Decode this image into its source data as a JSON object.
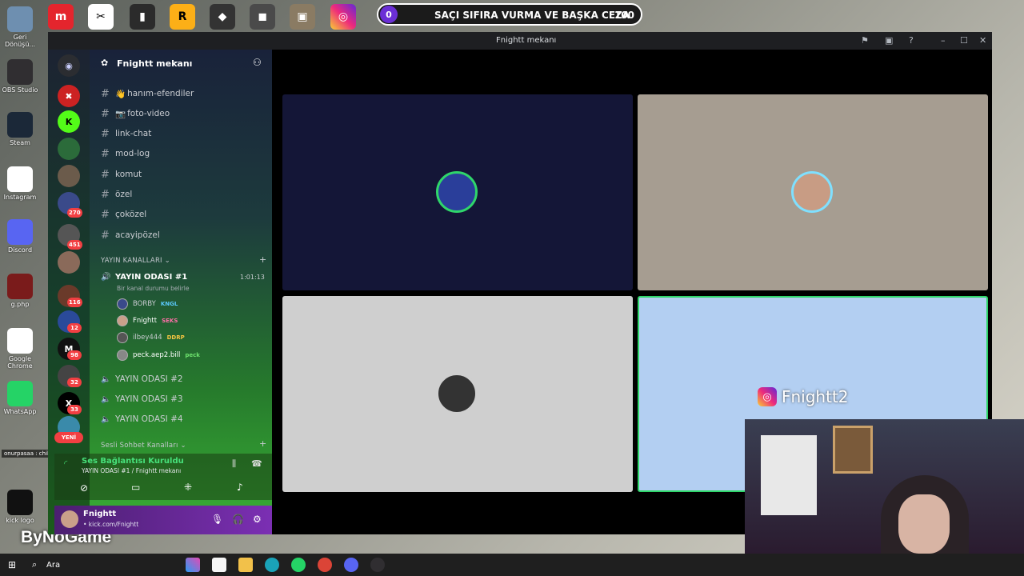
{
  "desktop": {
    "icons": [
      {
        "label": "Geri Dönüşü...",
        "icon": "recycle-bin-icon",
        "color": "#6e8fb0"
      },
      {
        "label": "OBS Studio",
        "icon": "obs-icon",
        "color": "#302e31"
      },
      {
        "label": "Steam",
        "icon": "steam-icon",
        "color": "#1b2838"
      },
      {
        "label": "Instagram",
        "icon": "chrome-icon",
        "color": "#ffffff"
      },
      {
        "label": "Discord",
        "icon": "discord-icon",
        "color": "#5865f2"
      },
      {
        "label": "g.php",
        "icon": "file-icon",
        "color": "#7a1b1b"
      },
      {
        "label": "Google Chrome",
        "icon": "chrome-icon",
        "color": "#ffffff"
      },
      {
        "label": "WhatsApp",
        "icon": "whatsapp-icon",
        "color": "#25d366"
      },
      {
        "label": "kick logo",
        "icon": "kick-icon",
        "color": "#111111"
      }
    ],
    "chat_overlay": "onurpasaa : chill guys",
    "bynogame": "ByNoGame"
  },
  "banner": {
    "left_value": "0",
    "title": "SAÇI SIFIRA VURMA VE BAŞKA CEZA",
    "right_value": "100"
  },
  "window": {
    "title": "Fnightt mekanı",
    "guild_name": "Fnightt mekanı",
    "text_channels": [
      {
        "name": "hanım-efendiler",
        "emoji": "👋"
      },
      {
        "name": "foto-video",
        "emoji": "📷"
      },
      {
        "name": "link-chat",
        "emoji": ""
      },
      {
        "name": "mod-log",
        "emoji": ""
      },
      {
        "name": "komut",
        "emoji": ""
      },
      {
        "name": "özel",
        "emoji": ""
      },
      {
        "name": "çoközel",
        "emoji": ""
      },
      {
        "name": "acayipözel",
        "emoji": ""
      }
    ],
    "category_stream": "YAYIN KANALLARI",
    "active_voice": {
      "name": "YAYIN ODASI #1",
      "timer": "1:01:13",
      "status_hint": "Bir kanal durumu belirle"
    },
    "voice_users": [
      {
        "name": "BORBY",
        "tag": "KNGL",
        "tag_color": "#5ac8fa"
      },
      {
        "name": "Fnightt",
        "tag": "SEKS",
        "tag_color": "#ff6fa8"
      },
      {
        "name": "ilbey444",
        "tag": "DDRP",
        "tag_color": "#f5c542"
      },
      {
        "name": "peck.aep2.bill",
        "tag": "peck",
        "tag_color": "#6ee36e"
      }
    ],
    "other_voice": [
      "YAYIN ODASI #2",
      "YAYIN ODASI #3",
      "YAYIN ODASI #4"
    ],
    "category_voice": "Sesli Sohbet Kanalları",
    "server_badges": [
      "270",
      "451",
      "116",
      "12",
      "98",
      "32",
      "33"
    ],
    "new_label": "YENİ",
    "voice_status": {
      "title": "Ses Bağlantısı Kuruldu",
      "subtitle": "YAYIN ODASI #1 / Fnightt mekanı"
    },
    "user": {
      "name": "Fnightt",
      "status": "• kick.com/Fnightt"
    },
    "stream_overlay_name": "Fnightt2"
  },
  "tiles": [
    {
      "bg": "#141637"
    },
    {
      "bg": "#a69d91"
    },
    {
      "bg": "#cfcfcf"
    },
    {
      "bg": "#b3cff2"
    }
  ],
  "taskbar": {
    "search": "Ara"
  }
}
